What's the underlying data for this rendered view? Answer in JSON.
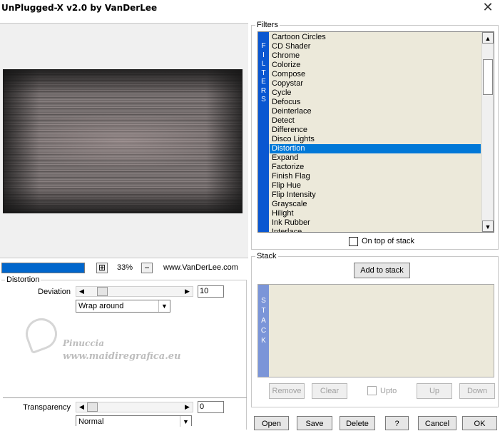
{
  "window": {
    "title": "UnPlugged-X v2.0 by VanDerLee"
  },
  "preview": {
    "progress": 1.0,
    "zoom_level": "33%",
    "website": "www.VanDerLee.com"
  },
  "distortion": {
    "group_label": "Distortion",
    "deviation": {
      "label": "Deviation",
      "value": "10"
    },
    "mode": {
      "selected": "Wrap around"
    },
    "transparency": {
      "label": "Transparency",
      "value": "0"
    },
    "blend": {
      "selected": "Normal"
    }
  },
  "watermark": {
    "name": "Pinuccia",
    "site": "www.maidiregrafica.eu"
  },
  "filters": {
    "group_label": "Filters",
    "strip": [
      "F",
      "I",
      "L",
      "T",
      "E",
      "R",
      "S"
    ],
    "items": [
      "Cartoon Circles",
      "CD Shader",
      "Chrome",
      "Colorize",
      "Compose",
      "Copystar",
      "Cycle",
      "Defocus",
      "Deinterlace",
      "Detect",
      "Difference",
      "Disco Lights",
      "Distortion",
      "Expand",
      "Factorize",
      "Finish Flag",
      "Flip Hue",
      "Flip Intensity",
      "Grayscale",
      "Hilight",
      "Ink Rubber",
      "Interlace"
    ],
    "selected": "Distortion",
    "on_top_label": "On top of stack"
  },
  "stack": {
    "group_label": "Stack",
    "add_label": "Add to stack",
    "strip": [
      "S",
      "T",
      "A",
      "C",
      "K"
    ],
    "remove_label": "Remove",
    "clear_label": "Clear",
    "upto_label": "Upto",
    "up_label": "Up",
    "down_label": "Down"
  },
  "buttons": {
    "open": "Open",
    "save": "Save",
    "delete": "Delete",
    "help": "?",
    "cancel": "Cancel",
    "ok": "OK"
  },
  "colors": {
    "accent": "#0078d7",
    "filters_strip": "#0a57d1",
    "stack_strip": "#7b95d8",
    "list_bg": "#ece9da"
  }
}
